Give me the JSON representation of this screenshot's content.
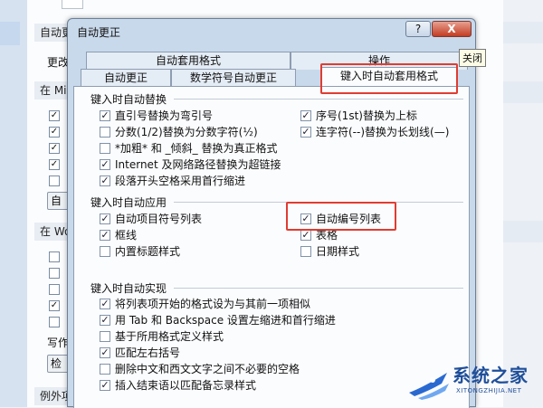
{
  "background": {
    "truncated_rows": [
      {
        "text": "自动更",
        "kind": "head"
      },
      {
        "text": "更改",
        "kind": "text"
      },
      {
        "text": "在 Mi",
        "kind": "head"
      },
      {
        "text": "在 Wo",
        "kind": "head"
      },
      {
        "text": "写作",
        "kind": "text"
      },
      {
        "text": "例外项",
        "kind": "head"
      }
    ],
    "buttons": [
      "自",
      "检"
    ]
  },
  "dialog": {
    "title": "自动更正",
    "help_label": "?",
    "close_label": "X",
    "close_tooltip": "关闭",
    "tabs_top": [
      "自动套用格式",
      "操作"
    ],
    "tabs_bottom": [
      "自动更正",
      "数学符号自动更正",
      "键入时自动套用格式"
    ],
    "active_tab": "键入时自动套用格式",
    "groups": [
      {
        "label": "键入时自动替换",
        "options": [
          {
            "label": "直引号替换为弯引号",
            "checked": true
          },
          {
            "label": "序号(1st)替换为上标",
            "checked": true
          },
          {
            "label": "分数(1/2)替换为分数字符(½)",
            "checked": false
          },
          {
            "label": "连字符(--)替换为长划线(—)",
            "checked": true
          },
          {
            "label": "*加粗* 和 _倾斜_ 替换为真正格式",
            "checked": false
          },
          {
            "label": "Internet 及网络路径替换为超链接",
            "checked": true
          },
          {
            "label": "段落开头空格采用首行缩进",
            "checked": true
          }
        ]
      },
      {
        "label": "键入时自动应用",
        "options": [
          {
            "label": "自动项目符号列表",
            "checked": true
          },
          {
            "label": "自动编号列表",
            "checked": true
          },
          {
            "label": "框线",
            "checked": true
          },
          {
            "label": "表格",
            "checked": true
          },
          {
            "label": "内置标题样式",
            "checked": false
          },
          {
            "label": "日期样式",
            "checked": false
          }
        ]
      },
      {
        "label": "键入时自动实现",
        "options": [
          {
            "label": "将列表项开始的格式设为与其前一项相似",
            "checked": true
          },
          {
            "label": "用 Tab 和 Backspace 设置左缩进和首行缩进",
            "checked": true
          },
          {
            "label": "基于所用格式定义样式",
            "checked": false
          },
          {
            "label": "匹配左右括号",
            "checked": true
          },
          {
            "label": "删除中文和西文文字之间不必要的空格",
            "checked": false
          },
          {
            "label": "插入结束语以匹配备忘录样式",
            "checked": true
          }
        ]
      }
    ]
  },
  "watermark": {
    "text": "系统之家",
    "url": "XITONGZHIJIA.NET"
  },
  "colors": {
    "highlight": "#e03c31",
    "dialog_frame": "#c9d9ec",
    "watermark": "#1f4f9a"
  }
}
